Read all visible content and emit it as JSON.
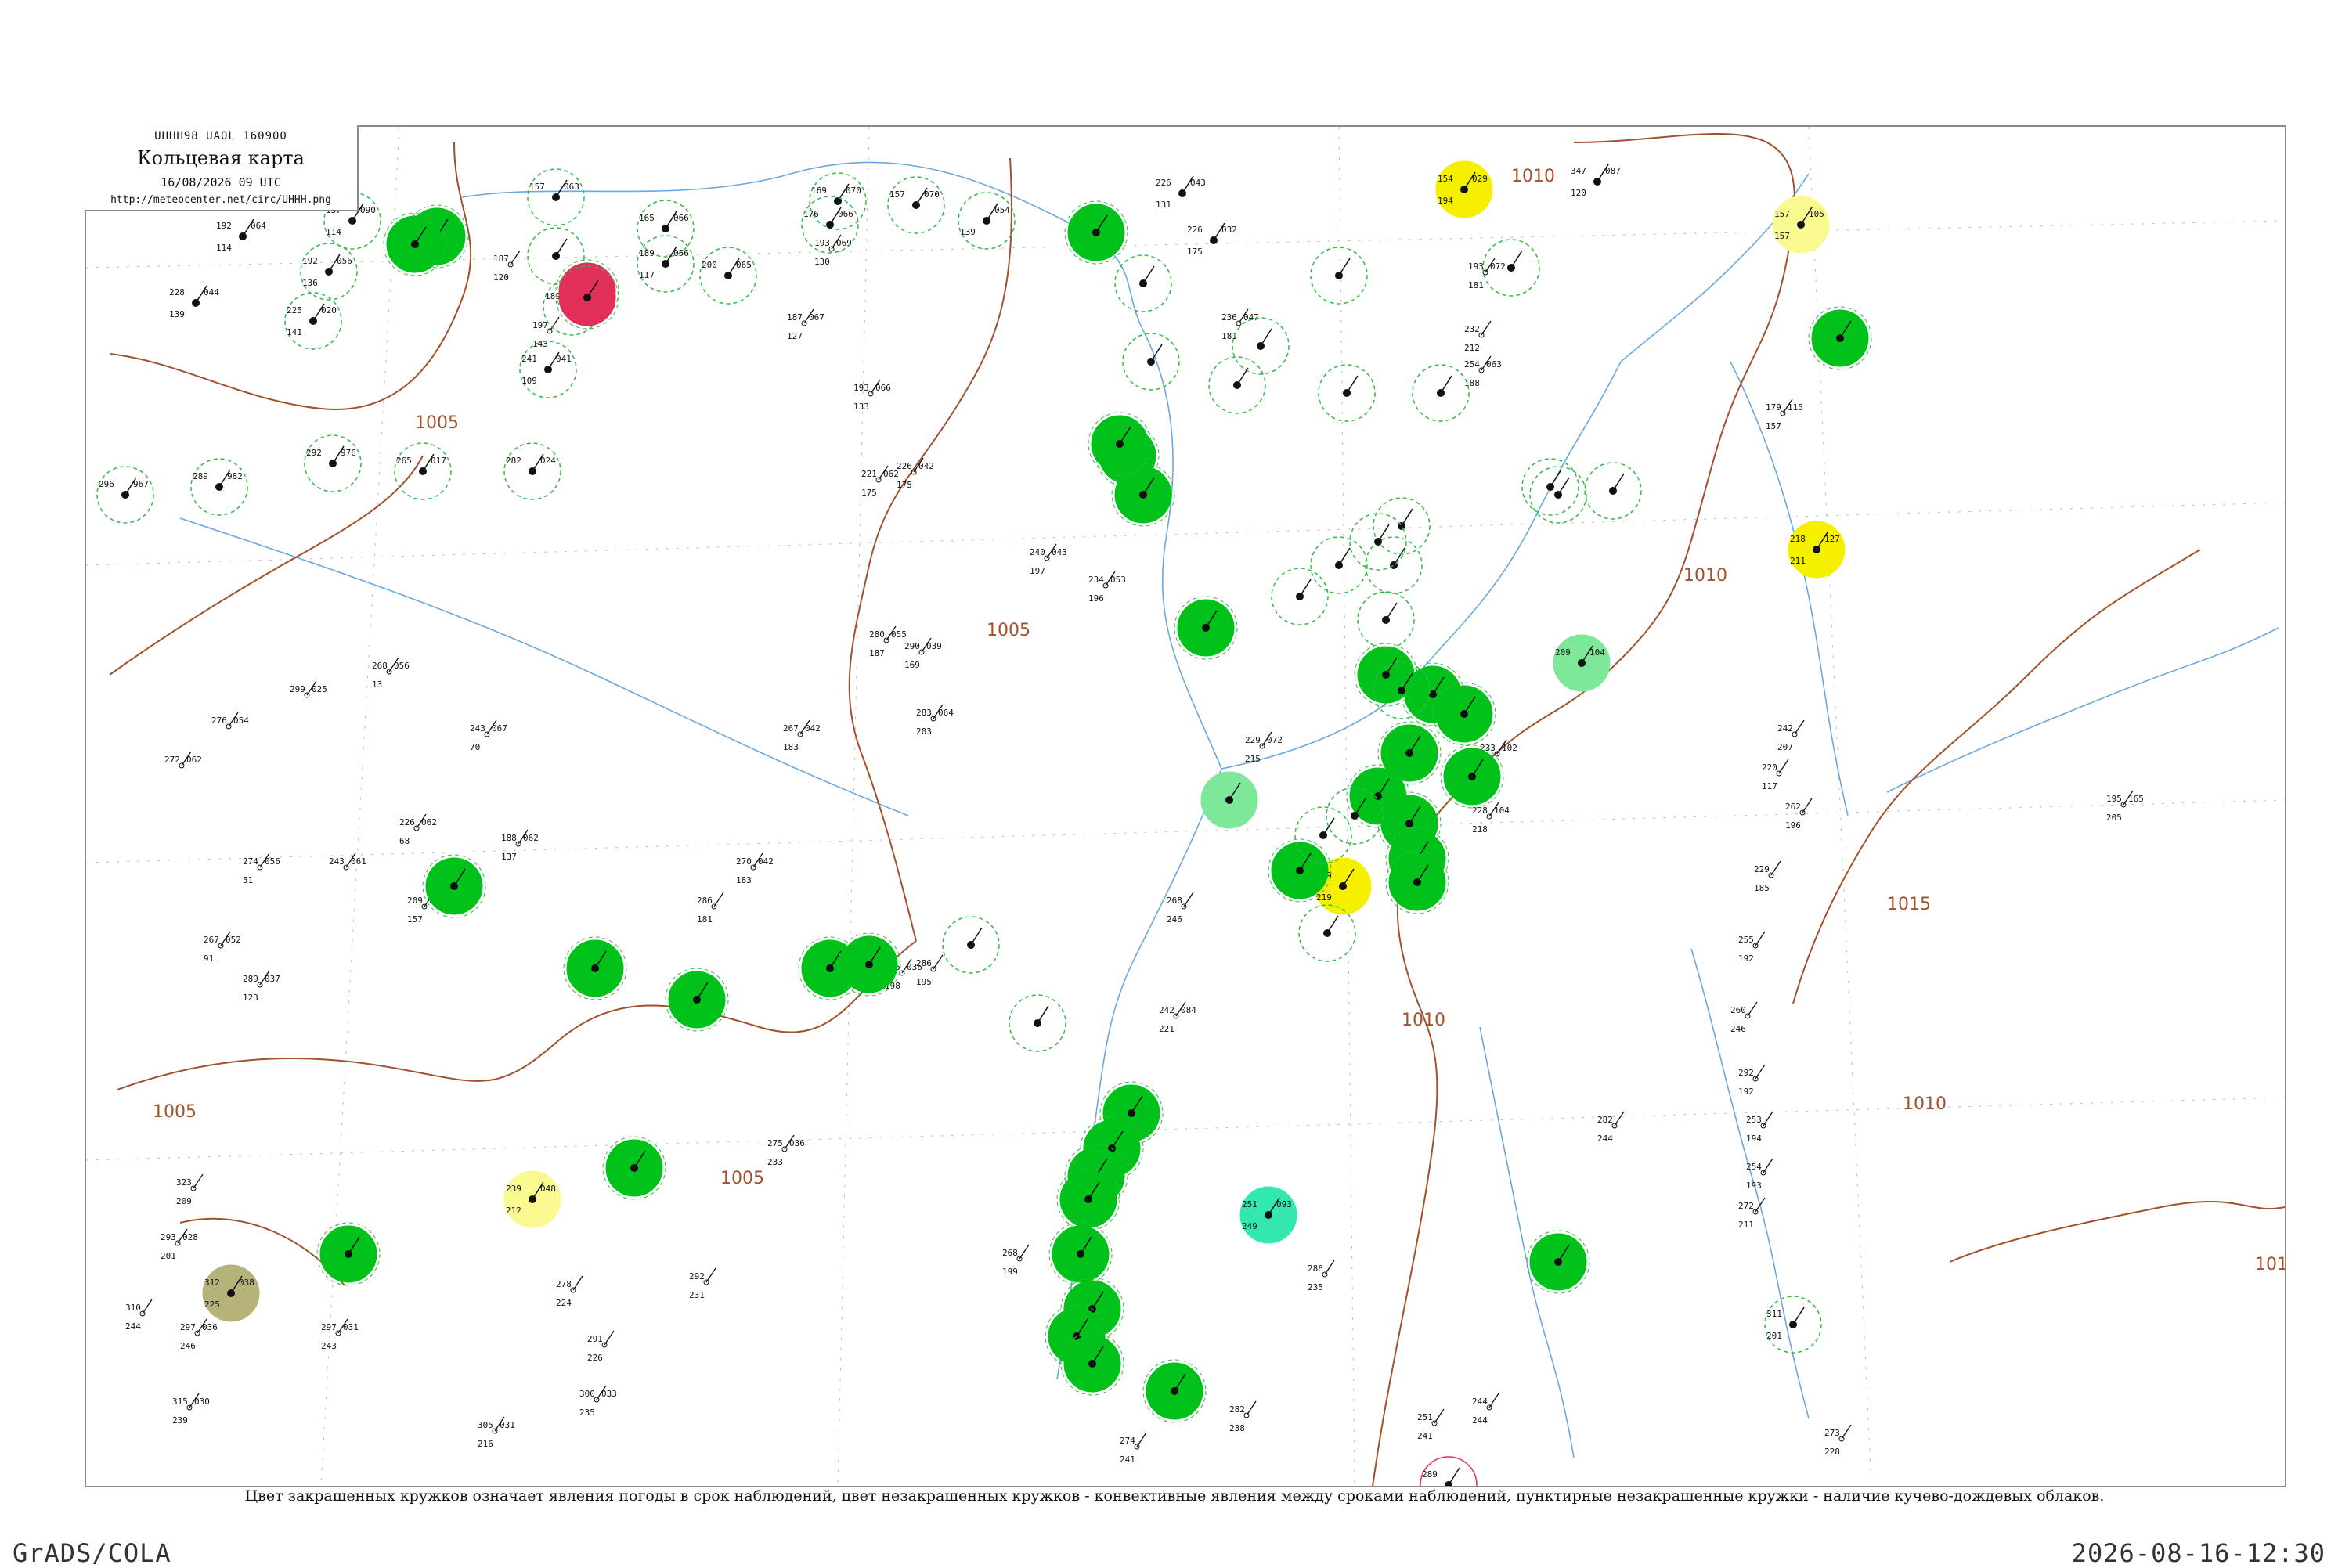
{
  "header": {
    "code_line": "UHHH98  UAOL  160900",
    "title": "Кольцевая карта",
    "datetime": "16/08/2026 09 UTC",
    "url": "http://meteocenter.net/circ/UHHH.png"
  },
  "caption": "Цвет закрашенных кружков означает явления погоды в срок наблюдений, цвет незакрашенных кружков - конвективные явления между сроками наблюдений, пунктирные незакрашенные кружки - наличие кучево-дождевых облаков.",
  "footer": {
    "left": "GrADS/COLA",
    "right": "2026-08-16-12:30"
  },
  "colors": {
    "rain": "#00c21a",
    "shower_light": "#7ee89a",
    "fog": "#f5f000",
    "haze": "#fafa90",
    "thunder": "#e0305a",
    "smoke": "#b5b27a",
    "drizzle": "#33e8b0",
    "cb_dashed": "#33bb44",
    "isobar": "#a0522d",
    "river": "#6aa8e0"
  },
  "isobars": [
    {
      "label": "1005"
    },
    {
      "label": "1005"
    },
    {
      "label": "1005"
    },
    {
      "label": "1005"
    },
    {
      "label": "1010"
    },
    {
      "label": "1010"
    },
    {
      "label": "1010"
    },
    {
      "label": "1015"
    },
    {
      "label": "1010"
    },
    {
      "label": "101"
    }
  ],
  "stations": [
    {
      "t": "192",
      "p": "064",
      "pt": "114",
      "kind": "none"
    },
    {
      "t": "137",
      "p": "090",
      "pt": "114",
      "kind": "cb"
    },
    {
      "t": "192",
      "p": "056",
      "pt": "136",
      "kind": "cb"
    },
    {
      "t": "228",
      "p": "044",
      "pt": "139",
      "kind": "none"
    },
    {
      "t": "225",
      "p": "020",
      "pt": "141",
      "kind": "cb"
    },
    {
      "t": "",
      "p": "",
      "pt": "",
      "kind": "rain"
    },
    {
      "t": "157",
      "p": "063",
      "pt": "",
      "kind": "cb"
    },
    {
      "t": "",
      "p": "",
      "pt": "",
      "kind": "cb"
    },
    {
      "t": "189",
      "p": "055",
      "pt": "",
      "kind": "cb"
    },
    {
      "t": "",
      "p": "",
      "pt": "",
      "kind": "thunder"
    },
    {
      "t": "165",
      "p": "066",
      "pt": "",
      "kind": "cb"
    },
    {
      "t": "189",
      "p": "056",
      "pt": "117",
      "kind": "cb"
    },
    {
      "t": "200",
      "p": "065",
      "pt": "",
      "kind": "cb"
    },
    {
      "t": "169",
      "p": "070",
      "pt": "",
      "kind": "cb"
    },
    {
      "t": "176",
      "p": "066",
      "pt": "",
      "kind": "cb"
    },
    {
      "t": "157",
      "p": "070",
      "pt": "",
      "kind": "cb"
    },
    {
      "t": "",
      "p": "054",
      "pt": "139",
      "kind": "cb"
    },
    {
      "t": "",
      "p": "",
      "pt": "",
      "kind": "rain"
    },
    {
      "t": "226",
      "p": "043",
      "pt": "131",
      "kind": "none"
    },
    {
      "t": "226",
      "p": "032",
      "pt": "175",
      "kind": "none"
    },
    {
      "t": "154",
      "p": "029",
      "pt": "194",
      "kind": "fog"
    },
    {
      "t": "347",
      "p": "087",
      "pt": "120",
      "kind": "none"
    },
    {
      "t": "157",
      "p": "105",
      "pt": "157",
      "kind": "haze"
    },
    {
      "t": "",
      "p": "",
      "pt": "",
      "kind": "rain"
    },
    {
      "t": "296",
      "p": "967",
      "pt": "",
      "kind": "cb"
    },
    {
      "t": "289",
      "p": "982",
      "pt": "",
      "kind": "cb"
    },
    {
      "t": "292",
      "p": "976",
      "pt": "",
      "kind": "cb"
    },
    {
      "t": "265",
      "p": "017",
      "pt": "",
      "kind": "cb"
    },
    {
      "t": "282",
      "p": "024",
      "pt": "",
      "kind": "cb"
    },
    {
      "t": "241",
      "p": "041",
      "pt": "109",
      "kind": "cb"
    },
    {
      "t": "",
      "p": "",
      "pt": "",
      "kind": "rain"
    },
    {
      "t": "",
      "p": "",
      "pt": "",
      "kind": "thunder"
    },
    {
      "t": "",
      "p": "",
      "pt": "",
      "kind": "rain"
    },
    {
      "t": "",
      "p": "",
      "pt": "",
      "kind": "rain"
    },
    {
      "t": "",
      "p": "",
      "pt": "",
      "kind": "rain"
    },
    {
      "t": "",
      "p": "",
      "pt": "",
      "kind": "rain"
    },
    {
      "t": "",
      "p": "",
      "pt": "",
      "kind": "rain"
    },
    {
      "t": "",
      "p": "",
      "pt": "",
      "kind": "rain"
    },
    {
      "t": "",
      "p": "",
      "pt": "",
      "kind": "rain"
    },
    {
      "t": "",
      "p": "",
      "pt": "",
      "kind": "rain"
    },
    {
      "t": "",
      "p": "",
      "pt": "",
      "kind": "rain"
    },
    {
      "t": "",
      "p": "",
      "pt": "",
      "kind": "rain"
    },
    {
      "t": "",
      "p": "",
      "pt": "",
      "kind": "shower_light"
    },
    {
      "t": "",
      "p": "",
      "pt": "",
      "kind": "rain"
    },
    {
      "t": "219",
      "p": "",
      "pt": "219",
      "kind": "fog"
    },
    {
      "t": "",
      "p": "",
      "pt": "",
      "kind": "rain"
    },
    {
      "t": "",
      "p": "",
      "pt": "",
      "kind": "rain"
    },
    {
      "t": "",
      "p": "",
      "pt": "",
      "kind": "rain"
    },
    {
      "t": "209",
      "p": "104",
      "pt": "",
      "kind": "shower_light"
    },
    {
      "t": "218",
      "p": "127",
      "pt": "211",
      "kind": "fog"
    },
    {
      "t": "",
      "p": "",
      "pt": "",
      "kind": "rain"
    },
    {
      "t": "",
      "p": "",
      "pt": "",
      "kind": "rain"
    },
    {
      "t": "",
      "p": "",
      "pt": "",
      "kind": "rain"
    },
    {
      "t": "",
      "p": "",
      "pt": "",
      "kind": "rain"
    },
    {
      "t": "239",
      "p": "048",
      "pt": "212",
      "kind": "haze"
    },
    {
      "t": "",
      "p": "",
      "pt": "",
      "kind": "rain"
    },
    {
      "t": "312",
      "p": "038",
      "pt": "225",
      "kind": "smoke"
    },
    {
      "t": "",
      "p": "",
      "pt": "",
      "kind": "rain"
    },
    {
      "t": "",
      "p": "",
      "pt": "",
      "kind": "rain"
    },
    {
      "t": "",
      "p": "",
      "pt": "",
      "kind": "rain"
    },
    {
      "t": "",
      "p": "",
      "pt": "",
      "kind": "rain"
    },
    {
      "t": "",
      "p": "",
      "pt": "",
      "kind": "rain"
    },
    {
      "t": "",
      "p": "",
      "pt": "",
      "kind": "rain"
    },
    {
      "t": "",
      "p": "",
      "pt": "",
      "kind": "rain"
    },
    {
      "t": "",
      "p": "",
      "pt": "",
      "kind": "rain"
    },
    {
      "t": "",
      "p": "",
      "pt": "",
      "kind": "rain"
    },
    {
      "t": "",
      "p": "",
      "pt": "",
      "kind": "rain"
    },
    {
      "t": "",
      "p": "",
      "pt": "",
      "kind": "rain"
    },
    {
      "t": "251",
      "p": "093",
      "pt": "249",
      "kind": "drizzle"
    },
    {
      "t": "289",
      "p": "",
      "pt": "240",
      "kind": "thunder_ring"
    },
    {
      "t": "",
      "p": "",
      "pt": "",
      "kind": "rain"
    },
    {
      "t": "311",
      "p": "",
      "pt": "201",
      "kind": "cb"
    },
    {
      "t": "",
      "p": "",
      "pt": "",
      "kind": "cb"
    },
    {
      "t": "",
      "p": "",
      "pt": "",
      "kind": "cb"
    },
    {
      "t": "",
      "p": "",
      "pt": "",
      "kind": "cb"
    },
    {
      "t": "",
      "p": "",
      "pt": "",
      "kind": "cb"
    },
    {
      "t": "",
      "p": "",
      "pt": "",
      "kind": "cb"
    },
    {
      "t": "",
      "p": "",
      "pt": "",
      "kind": "cb"
    },
    {
      "t": "",
      "p": "",
      "pt": "",
      "kind": "cb"
    },
    {
      "t": "",
      "p": "",
      "pt": "",
      "kind": "cb"
    },
    {
      "t": "",
      "p": "",
      "pt": "",
      "kind": "cb"
    },
    {
      "t": "",
      "p": "",
      "pt": "",
      "kind": "cb"
    },
    {
      "t": "",
      "p": "",
      "pt": "",
      "kind": "cb"
    },
    {
      "t": "",
      "p": "",
      "pt": "",
      "kind": "cb"
    },
    {
      "t": "",
      "p": "",
      "pt": "",
      "kind": "cb"
    },
    {
      "t": "",
      "p": "",
      "pt": "",
      "kind": "cb"
    },
    {
      "t": "",
      "p": "",
      "pt": "",
      "kind": "cb"
    },
    {
      "t": "",
      "p": "",
      "pt": "",
      "kind": "cb"
    },
    {
      "t": "",
      "p": "",
      "pt": "",
      "kind": "cb"
    },
    {
      "t": "",
      "p": "",
      "pt": "",
      "kind": "cb"
    },
    {
      "t": "",
      "p": "",
      "pt": "",
      "kind": "cb"
    },
    {
      "t": "",
      "p": "",
      "pt": "",
      "kind": "cb"
    },
    {
      "t": "",
      "p": "",
      "pt": "",
      "kind": "cb"
    },
    {
      "t": "",
      "p": "",
      "pt": "",
      "kind": "cb"
    },
    {
      "t": "",
      "p": "",
      "pt": "",
      "kind": "cb"
    }
  ],
  "plain_stations": [
    {
      "t": "187",
      "p": "",
      "pt": "120"
    },
    {
      "t": "197",
      "p": "",
      "pt": "143"
    },
    {
      "t": "193",
      "p": "069",
      "pt": "130"
    },
    {
      "t": "193",
      "p": "066",
      "pt": "133"
    },
    {
      "t": "187",
      "p": "067",
      "pt": "127"
    },
    {
      "t": "236",
      "p": "047",
      "pt": "181"
    },
    {
      "t": "232",
      "p": "",
      "pt": "212"
    },
    {
      "t": "193",
      "p": "072",
      "pt": "181"
    },
    {
      "t": "254",
      "p": "063",
      "pt": "188"
    },
    {
      "t": "179",
      "p": "115",
      "pt": "157"
    },
    {
      "t": "226",
      "p": "042",
      "pt": "175"
    },
    {
      "t": "221",
      "p": "062",
      "pt": "175"
    },
    {
      "t": "280",
      "p": "055",
      "pt": "187"
    },
    {
      "t": "290",
      "p": "039",
      "pt": "169"
    },
    {
      "t": "240",
      "p": "043",
      "pt": "197"
    },
    {
      "t": "234",
      "p": "053",
      "pt": "196"
    },
    {
      "t": "272",
      "p": "062",
      "pt": ""
    },
    {
      "t": "276",
      "p": "054",
      "pt": ""
    },
    {
      "t": "299",
      "p": "025",
      "pt": ""
    },
    {
      "t": "268",
      "p": "056",
      "pt": "13"
    },
    {
      "t": "243",
      "p": "067",
      "pt": "70"
    },
    {
      "t": "267",
      "p": "042",
      "pt": "183"
    },
    {
      "t": "283",
      "p": "064",
      "pt": "203"
    },
    {
      "t": "229",
      "p": "072",
      "pt": "215"
    },
    {
      "t": "226",
      "p": "062",
      "pt": "68"
    },
    {
      "t": "188",
      "p": "062",
      "pt": "137"
    },
    {
      "t": "274",
      "p": "056",
      "pt": "51"
    },
    {
      "t": "243",
      "p": "061",
      "pt": ""
    },
    {
      "t": "209",
      "p": "060",
      "pt": "157"
    },
    {
      "t": "267",
      "p": "052",
      "pt": "91"
    },
    {
      "t": "289",
      "p": "037",
      "pt": "123"
    },
    {
      "t": "286",
      "p": "",
      "pt": "181"
    },
    {
      "t": "270",
      "p": "042",
      "pt": "183"
    },
    {
      "t": "295",
      "p": "036",
      "pt": "198"
    },
    {
      "t": "286",
      "p": "",
      "pt": "195"
    },
    {
      "t": "242",
      "p": "084",
      "pt": "221"
    },
    {
      "t": "268",
      "p": "",
      "pt": "246"
    },
    {
      "t": "233",
      "p": "102",
      "pt": "223"
    },
    {
      "t": "228",
      "p": "104",
      "pt": "218"
    },
    {
      "t": "242",
      "p": "",
      "pt": "207"
    },
    {
      "t": "220",
      "p": "",
      "pt": "117"
    },
    {
      "t": "262",
      "p": "",
      "pt": "196"
    },
    {
      "t": "195",
      "p": "165",
      "pt": "205"
    },
    {
      "t": "229",
      "p": "",
      "pt": "185"
    },
    {
      "t": "255",
      "p": "",
      "pt": "192"
    },
    {
      "t": "260",
      "p": "",
      "pt": "246"
    },
    {
      "t": "292",
      "p": "",
      "pt": "192"
    },
    {
      "t": "253",
      "p": "",
      "pt": "194"
    },
    {
      "t": "254",
      "p": "",
      "pt": "193"
    },
    {
      "t": "272",
      "p": "",
      "pt": "211"
    },
    {
      "t": "323",
      "p": "",
      "pt": "209"
    },
    {
      "t": "293",
      "p": "028",
      "pt": "201"
    },
    {
      "t": "310",
      "p": "",
      "pt": "244"
    },
    {
      "t": "315",
      "p": "030",
      "pt": "239"
    },
    {
      "t": "297",
      "p": "036",
      "pt": "246"
    },
    {
      "t": "297",
      "p": "031",
      "pt": "243"
    },
    {
      "t": "305",
      "p": "031",
      "pt": "216"
    },
    {
      "t": "300",
      "p": "033",
      "pt": "235"
    },
    {
      "t": "278",
      "p": "",
      "pt": "224"
    },
    {
      "t": "291",
      "p": "",
      "pt": "226"
    },
    {
      "t": "275",
      "p": "036",
      "pt": "233"
    },
    {
      "t": "292",
      "p": "",
      "pt": "231"
    },
    {
      "t": "268",
      "p": "",
      "pt": "199"
    },
    {
      "t": "274",
      "p": "",
      "pt": "241"
    },
    {
      "t": "282",
      "p": "",
      "pt": "238"
    },
    {
      "t": "286",
      "p": "",
      "pt": "235"
    },
    {
      "t": "251",
      "p": "",
      "pt": "241"
    },
    {
      "t": "244",
      "p": "",
      "pt": "244"
    },
    {
      "t": "282",
      "p": "",
      "pt": "244"
    },
    {
      "t": "273",
      "p": "",
      "pt": "228"
    }
  ]
}
